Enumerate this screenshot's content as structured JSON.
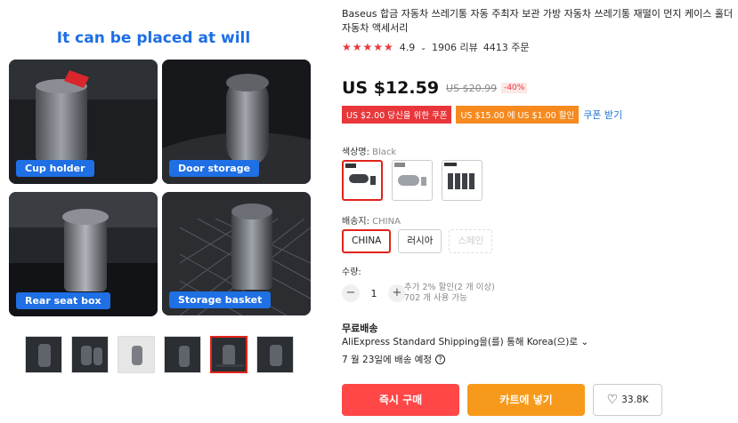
{
  "gallery": {
    "heading": "It can be placed at will",
    "tiles": [
      {
        "caption": "Cup holder"
      },
      {
        "caption": "Door storage"
      },
      {
        "caption": "Rear seat box"
      },
      {
        "caption": "Storage basket"
      }
    ],
    "thumbnail_count": 6,
    "active_thumbnail": 5
  },
  "product": {
    "title": "Baseus 합금 자동차 쓰레기통 자동 주최자 보관 가방 자동차 쓰레기통 재떨이 먼지 케이스 홀더 자동차 액세서리",
    "rating": "4.9",
    "reviews": "1906 리뷰",
    "orders": "4413 주문"
  },
  "price": {
    "current": "US $12.59",
    "original": "US $20.99",
    "discount": "-40%"
  },
  "coupons": {
    "new_user": "US $2.00 당신을 위한 쿠폰",
    "store": "US $15.00 에 US $1.00 할인",
    "get_link": "쿠폰 받기"
  },
  "color": {
    "label": "색상명:",
    "selected": "Black"
  },
  "shipping_from": {
    "label": "배송지:",
    "selected": "CHINA",
    "options": [
      "CHINA",
      "러시아",
      "스페인"
    ]
  },
  "quantity": {
    "label": "수량:",
    "value": "1",
    "note_line1": "추가 2% 할인(2 개 이상)",
    "note_line2": "702 개 사용 가능"
  },
  "delivery": {
    "free_label": "무료배송",
    "method": "AliExpress Standard Shipping을(를) 통해 Korea(으)로 ⌄",
    "date": "7 월 23일에 배송 예정"
  },
  "actions": {
    "buy_now": "즉시 구매",
    "add_to_cart": "카트에 넣기",
    "wishlist_count": "33.8K"
  },
  "colors": {
    "accent_red": "#e8363a",
    "accent_orange": "#f68a1e",
    "link_blue": "#1b71d8",
    "caption_blue": "#1f6fe5"
  }
}
